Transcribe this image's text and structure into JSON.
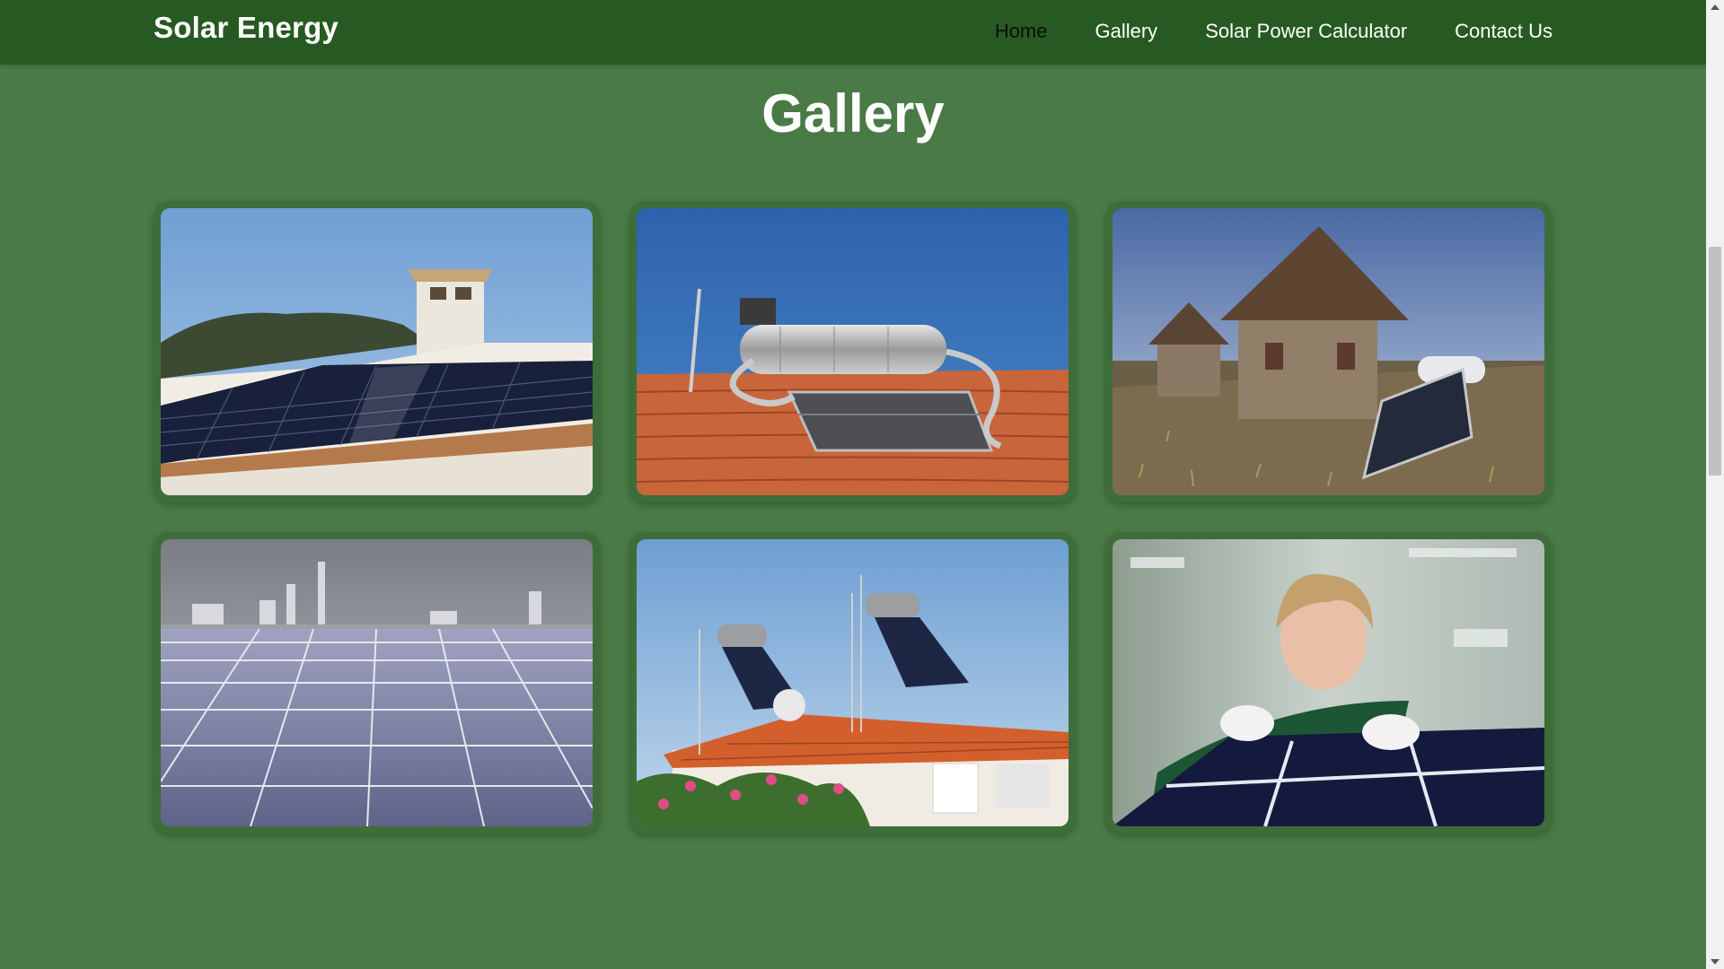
{
  "header": {
    "brand": "Solar Energy",
    "nav": [
      "Home",
      "Gallery",
      "Solar Power Calculator",
      "Contact Us"
    ],
    "active_nav": "Home"
  },
  "main": {
    "title": "Gallery",
    "images": [
      {
        "subject": "solar panels on tiled roof with chimney and hills"
      },
      {
        "subject": "solar water heater on orange roof tiles"
      },
      {
        "subject": "solar water heater beside stone thatched huts"
      },
      {
        "subject": "large field of rooftop solar panels with city skyline"
      },
      {
        "subject": "solar water heaters on white house with flowers"
      },
      {
        "subject": "technician in gloves inspecting solar panel"
      }
    ]
  },
  "colors": {
    "page_background": "#4a7a46",
    "navbar_background": "#275a22",
    "card_border": "#3d6d39",
    "text": "#ffffff",
    "active_nav_text": "#0d0d0d"
  }
}
